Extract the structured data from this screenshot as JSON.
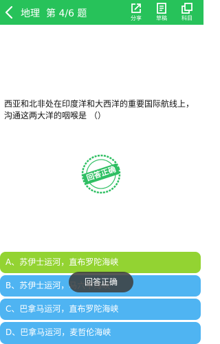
{
  "header": {
    "subject": "地理",
    "progress": "第 4/6 题",
    "share_label": "分享",
    "draft_label": "草稿",
    "subject_label": "科目",
    "icons": {
      "back": "chevron-left-icon",
      "share": "share-icon",
      "draft": "note-icon",
      "subject": "copy-icon"
    }
  },
  "question": {
    "text": "西亚和北非处在印度洋和大西洋的重要国际航线上，沟通这两大洋的咽喉是 （）"
  },
  "stamp": {
    "text": "回答正确",
    "icon": "correct-stamp-icon"
  },
  "options": [
    {
      "text": "A、苏伊士运河，直布罗陀海峡",
      "state": "correct"
    },
    {
      "text": "B、苏伊士运河，马六甲海峡",
      "state": "normal"
    },
    {
      "text": "C、巴拿马运河，直布罗陀海峡",
      "state": "normal"
    },
    {
      "text": "D、巴拿马运河，麦哲伦海峡",
      "state": "normal"
    }
  ],
  "toast": {
    "text": "回答正确"
  },
  "colors": {
    "header": "#27c25a",
    "correct_option": "#93d332",
    "option": "#4fb4f2",
    "stamp": "#2fbf63"
  }
}
